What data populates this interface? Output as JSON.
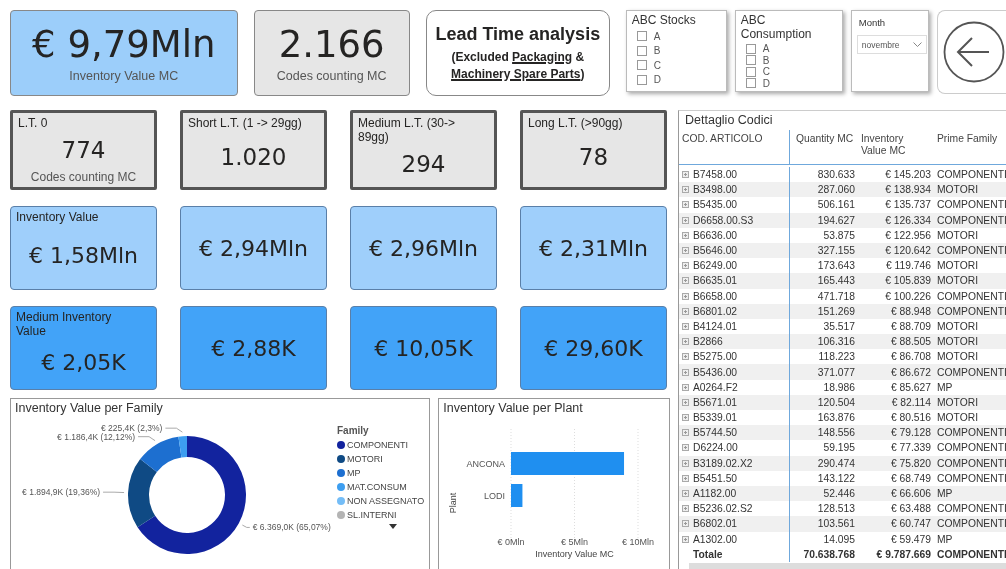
{
  "kpis": [
    {
      "value": "€ 9,79Mln",
      "label": "Inventory Value MC",
      "kind": "blue"
    },
    {
      "value": "2.166",
      "label": "Codes counting MC",
      "kind": "gray"
    }
  ],
  "title": {
    "heading": "Lead Time analysis",
    "lines": [
      [
        {
          "text": "(Excluded ",
          "underlined": false
        },
        {
          "text": "Packaging",
          "underlined": true
        },
        {
          "text": " &",
          "underlined": false
        }
      ],
      [
        {
          "text": "Machinery Spare Parts",
          "underlined": true
        },
        {
          "text": ")",
          "underlined": false
        }
      ]
    ]
  },
  "filters": [
    {
      "title": "ABC Stocks",
      "options": [
        {
          "label": "A",
          "checked": false
        },
        {
          "label": "B",
          "checked": false
        },
        {
          "label": "C",
          "checked": false
        },
        {
          "label": "D",
          "checked": false
        }
      ]
    },
    {
      "title": "ABC Consumption",
      "options": [
        {
          "label": "A",
          "checked": false
        },
        {
          "label": "B",
          "checked": false
        },
        {
          "label": "C",
          "checked": false
        },
        {
          "label": "D",
          "checked": false
        }
      ]
    }
  ],
  "month": {
    "title": "Month",
    "value": "novembre"
  },
  "card_rows": [
    {
      "kind": "count",
      "cards": [
        {
          "title": "L.T. 0",
          "value": "774",
          "caption": "Codes counting MC"
        },
        {
          "title": "Short L.T. (1 -> 29gg)",
          "value": "1.020"
        },
        {
          "title": "Medium L.T. (30-> 89gg)",
          "value": "294"
        },
        {
          "title": "Long L.T. (>90gg)",
          "value": "78"
        }
      ]
    },
    {
      "kind": "value",
      "cards": [
        {
          "title": "Inventory Value",
          "value": "€ 1,58Mln"
        },
        {
          "value": "€ 2,94Mln"
        },
        {
          "value": "€ 2,96Mln"
        },
        {
          "value": "€ 2,31Mln"
        }
      ]
    },
    {
      "kind": "medium",
      "cards": [
        {
          "title": "Medium Inventory Value",
          "value": "€ 2,05K"
        },
        {
          "value": "€ 2,88K"
        },
        {
          "value": "€ 10,05K"
        },
        {
          "value": "€ 29,60K"
        }
      ]
    }
  ],
  "family_panel": {
    "title": "Inventory Value per Family",
    "legend_title": "Family",
    "chart_data": {
      "type": "donut",
      "categories": [
        "COMPONENTI",
        "MOTORI",
        "MP",
        "MAT.CONSUM",
        "NON ASSEGNATO",
        "SL.INTERNI"
      ],
      "series": [
        {
          "values": [
            65.07,
            19.36,
            12.12,
            2.3,
            null,
            null
          ]
        }
      ],
      "colors": [
        "#12239e",
        "#0f4a84",
        "#1d6fd0",
        "#3d9ef0",
        "#74bdf7",
        "#b4b4b4"
      ],
      "value_labels": [
        "€ 6.369,0K (65,07%)",
        "€ 1.894,9K (19,36%)",
        "€ 1.186,4K (12,12%)",
        "€ 225,4K (2,3%)",
        null,
        null
      ]
    }
  },
  "plant_panel": {
    "title": "Inventory Value per Plant",
    "chart_data": {
      "type": "bar",
      "orientation": "horizontal",
      "categories": [
        "ANCONA",
        "LODI"
      ],
      "series": [
        {
          "color": "#1f8ff0",
          "values": [
            8.9,
            0.9
          ]
        }
      ],
      "xlabel": "Inventory Value MC",
      "ylabel": "Plant",
      "xlim": [
        0,
        10
      ],
      "xticks": [
        {
          "value": 0,
          "label": "€ 0Mln"
        },
        {
          "value": 5,
          "label": "€ 5Mln"
        },
        {
          "value": 10,
          "label": "€ 10Mln"
        }
      ]
    }
  },
  "table": {
    "title": "Dettaglio Codici",
    "columns": [
      "COD. ARTICOLO",
      "Quantity MC",
      "Inventory Value MC",
      "Prime Family"
    ],
    "rows": [
      [
        "B7458.00",
        "830.633",
        "€ 145.203",
        "COMPONENTI"
      ],
      [
        "B3498.00",
        "287.060",
        "€ 138.934",
        "MOTORI"
      ],
      [
        "B5435.00",
        "506.161",
        "€ 135.737",
        "COMPONENTI"
      ],
      [
        "D6658.00.S3",
        "194.627",
        "€ 126.334",
        "COMPONENTI"
      ],
      [
        "B6636.00",
        "53.875",
        "€ 122.956",
        "MOTORI"
      ],
      [
        "B5646.00",
        "327.155",
        "€ 120.642",
        "COMPONENTI"
      ],
      [
        "B6249.00",
        "173.643",
        "€ 119.746",
        "MOTORI"
      ],
      [
        "B6635.01",
        "165.443",
        "€ 105.839",
        "MOTORI"
      ],
      [
        "B6658.00",
        "471.718",
        "€ 100.226",
        "COMPONENTI"
      ],
      [
        "B6801.02",
        "151.269",
        "€ 88.948",
        "COMPONENTI"
      ],
      [
        "B4124.01",
        "35.517",
        "€ 88.709",
        "MOTORI"
      ],
      [
        "B2866",
        "106.316",
        "€ 88.505",
        "MOTORI"
      ],
      [
        "B5275.00",
        "118.223",
        "€ 86.708",
        "MOTORI"
      ],
      [
        "B5436.00",
        "371.077",
        "€ 86.672",
        "COMPONENTI"
      ],
      [
        "A0264.F2",
        "18.986",
        "€ 85.627",
        "MP"
      ],
      [
        "B5671.01",
        "120.504",
        "€ 82.114",
        "MOTORI"
      ],
      [
        "B5339.01",
        "163.876",
        "€ 80.516",
        "MOTORI"
      ],
      [
        "B5744.50",
        "148.556",
        "€ 79.128",
        "COMPONENTI"
      ],
      [
        "D6224.00",
        "59.195",
        "€ 77.339",
        "COMPONENTI"
      ],
      [
        "B3189.02.X2",
        "290.474",
        "€ 75.820",
        "COMPONENTI"
      ],
      [
        "B5451.50",
        "143.122",
        "€ 68.749",
        "COMPONENTI"
      ],
      [
        "A1182.00",
        "52.446",
        "€ 66.606",
        "MP"
      ],
      [
        "B5236.02.S2",
        "128.513",
        "€ 63.488",
        "COMPONENTI"
      ],
      [
        "B6802.01",
        "103.561",
        "€ 60.747",
        "COMPONENTI"
      ],
      [
        "A1302.00",
        "14.095",
        "€ 59.479",
        "MP"
      ]
    ],
    "total": [
      "Totale",
      "70.638.768",
      "€ 9.787.669",
      "COMPONENTI"
    ]
  }
}
